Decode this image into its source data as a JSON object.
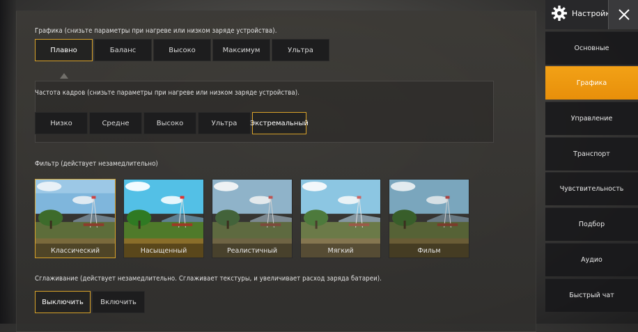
{
  "graphics": {
    "label": "Графика (снизьте параметры при нагреве или низком заряде устройства).",
    "options": [
      "Плавно",
      "Баланс",
      "Высоко",
      "Максимум",
      "Ультра"
    ],
    "selected_index": 0
  },
  "fps": {
    "label": "Частота кадров (снизьте параметры при нагреве или низком заряде устройства).",
    "options": [
      "Низко",
      "Средне",
      "Высоко",
      "Ультра",
      "Экстремальный"
    ],
    "selected_index": 4
  },
  "filter": {
    "label": "Фильтр (действует незамедлительно)",
    "options": [
      "Классический",
      "Насыщенный",
      "Реалистичный",
      "Мягкий",
      "Фильм"
    ],
    "selected_index": 0
  },
  "antialiasing": {
    "label": "Сглаживание (действует незамедлительно. Сглаживает текстуры, и увеличивает расход заряда батареи).",
    "options": [
      "Выключить",
      "Включить"
    ],
    "selected_index": 0
  },
  "sidebar": {
    "title": "Настройки",
    "items": [
      "Основные",
      "Графика",
      "Управление",
      "Транспорт",
      "Чувствительность",
      "Подбор",
      "Аудио",
      "Быстрый чат"
    ],
    "active_index": 1
  },
  "colors": {
    "accent": "#f2a116",
    "selected_border": "#d9a32a"
  },
  "icons": {
    "settings": "gear-icon",
    "close": "close-icon"
  }
}
